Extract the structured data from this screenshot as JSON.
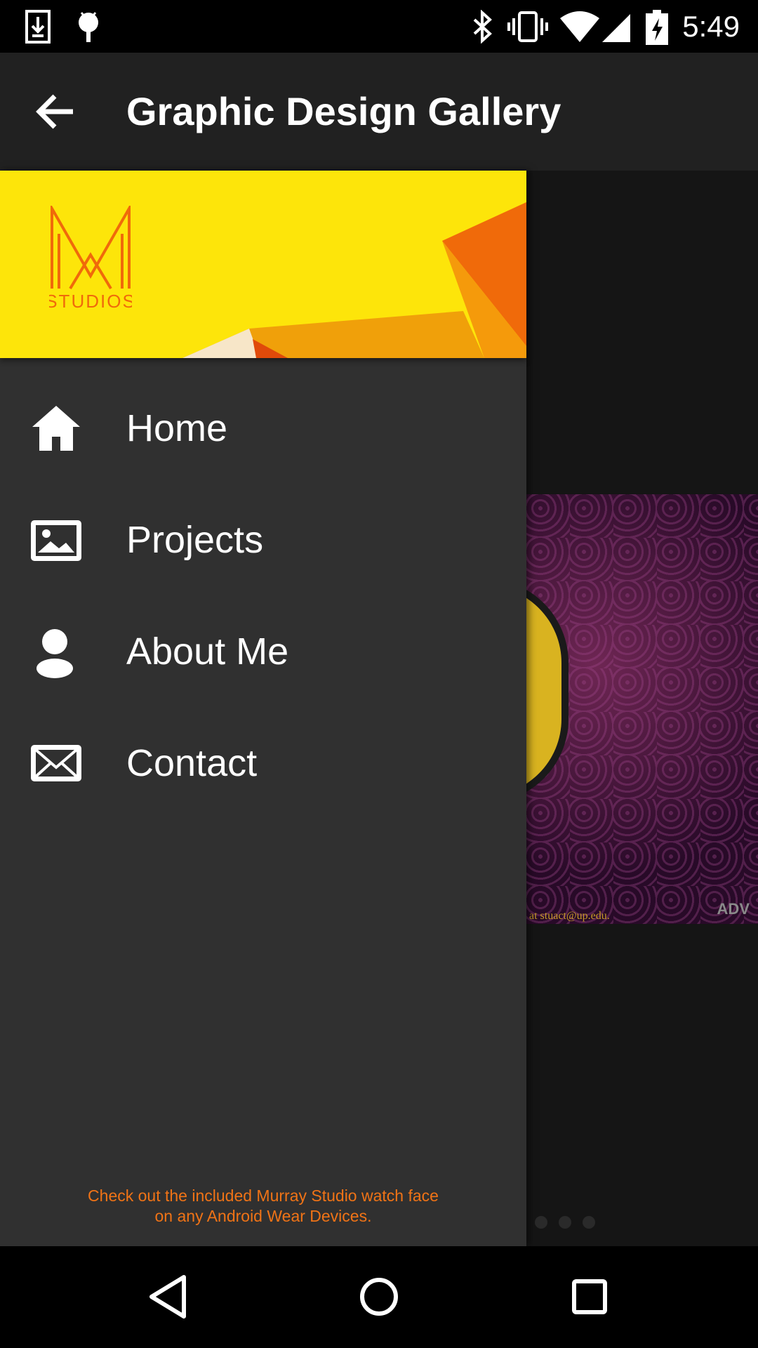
{
  "status_bar": {
    "time": "5:49",
    "icons": [
      "download-icon",
      "android-debug-icon",
      "bluetooth-icon",
      "vibrate-icon",
      "wifi-icon",
      "cell-signal-icon",
      "battery-charging-icon"
    ]
  },
  "app_bar": {
    "title": "Graphic Design Gallery",
    "back_icon": "arrow-left-icon"
  },
  "drawer": {
    "header": {
      "logo_text": "STUDIOS",
      "colors": {
        "background": "#fde50a",
        "accent": "#f06a0a",
        "orange": "#f5a10b"
      }
    },
    "items": [
      {
        "label": "Home",
        "icon": "home-icon"
      },
      {
        "label": "Projects",
        "icon": "image-icon"
      },
      {
        "label": "About Me",
        "icon": "person-icon"
      },
      {
        "label": "Contact",
        "icon": "mail-icon"
      }
    ],
    "footer": {
      "line1": "Check out the included Murray Studio watch face",
      "line2": "on any Android Wear Devices.",
      "color": "#f07316"
    }
  },
  "content": {
    "image_caption": "at stuact@up.edu.",
    "image_badge": "ADV",
    "pager_dot_count": 3
  },
  "nav_bar": {
    "buttons": [
      "back-triangle-icon",
      "home-circle-icon",
      "recents-square-icon"
    ]
  }
}
